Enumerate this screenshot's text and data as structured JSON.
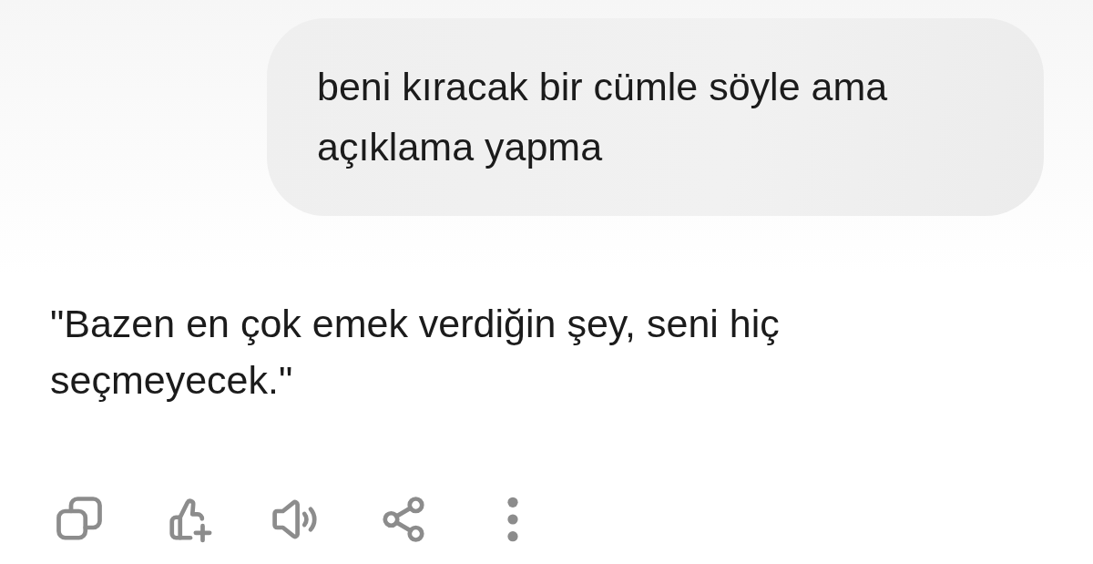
{
  "user_message": {
    "text": "beni kıracak bir cümle söyle ama açıklama yapma"
  },
  "assistant_message": {
    "text": "\"Bazen en çok emek verdiğin şey, seni hiç seçmeyecek.\""
  }
}
